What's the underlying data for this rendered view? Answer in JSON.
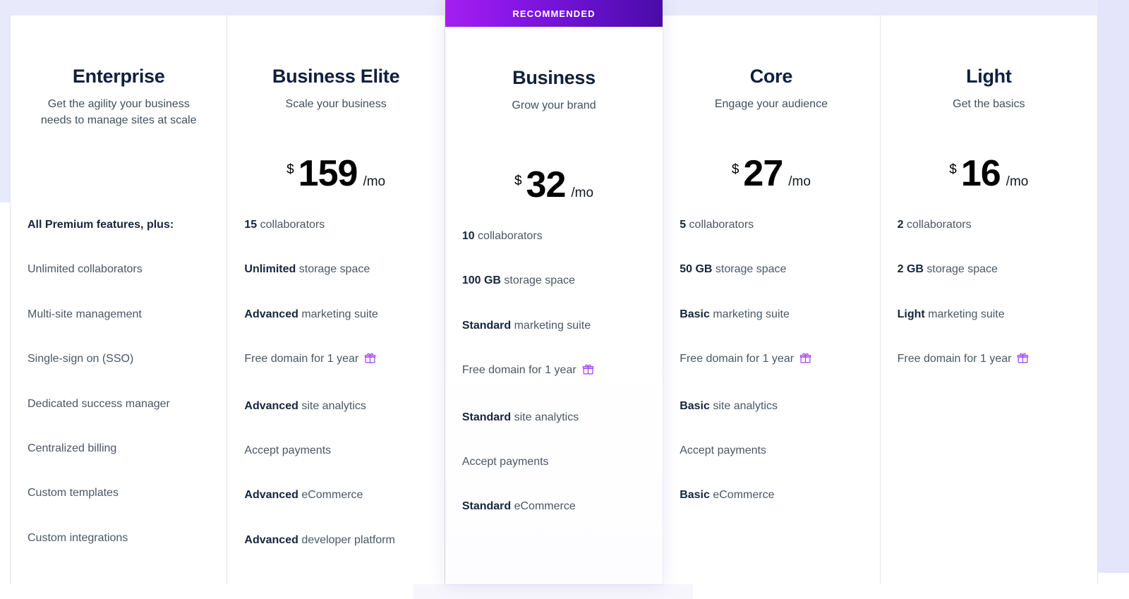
{
  "colors": {
    "page_background": "#ffffff",
    "backdrop_lavender": "#e8e9fb",
    "ribbon_gradient_start": "#a41ff0",
    "ribbon_gradient_end": "#4a0ba8",
    "heading_text": "#10203c",
    "body_text": "#4a5765",
    "gift_icon": "#a23ff0",
    "card_border": "#e3e5e8"
  },
  "ribbon": {
    "label": "RECOMMENDED"
  },
  "plans": [
    {
      "id": "enterprise",
      "name": "Enterprise",
      "tagline": "Get the agility your business needs to manage sites at scale",
      "featured": false,
      "has_price": false,
      "price": {
        "currency": "",
        "amount": "",
        "period": ""
      },
      "features": [
        {
          "strong": "All Premium features, plus:",
          "rest": "",
          "heading": true,
          "gift": false
        },
        {
          "strong": "",
          "rest": "Unlimited collaborators",
          "heading": false,
          "gift": false
        },
        {
          "strong": "",
          "rest": "Multi-site management",
          "heading": false,
          "gift": false
        },
        {
          "strong": "",
          "rest": "Single-sign on (SSO)",
          "heading": false,
          "gift": false
        },
        {
          "strong": "",
          "rest": "Dedicated success manager",
          "heading": false,
          "gift": false
        },
        {
          "strong": "",
          "rest": "Centralized billing",
          "heading": false,
          "gift": false
        },
        {
          "strong": "",
          "rest": "Custom templates",
          "heading": false,
          "gift": false
        },
        {
          "strong": "",
          "rest": "Custom integrations",
          "heading": false,
          "gift": false
        }
      ]
    },
    {
      "id": "business-elite",
      "name": "Business Elite",
      "tagline": "Scale your business",
      "featured": false,
      "has_price": true,
      "price": {
        "currency": "$",
        "amount": "159",
        "period": "/mo"
      },
      "features": [
        {
          "strong": "15",
          "rest": " collaborators",
          "heading": false,
          "gift": false
        },
        {
          "strong": "Unlimited",
          "rest": " storage space",
          "heading": false,
          "gift": false
        },
        {
          "strong": "Advanced",
          "rest": " marketing suite",
          "heading": false,
          "gift": false
        },
        {
          "strong": "",
          "rest": "Free domain for 1 year",
          "heading": false,
          "gift": true
        },
        {
          "strong": "Advanced",
          "rest": " site analytics",
          "heading": false,
          "gift": false
        },
        {
          "strong": "",
          "rest": "Accept payments",
          "heading": false,
          "gift": false
        },
        {
          "strong": "Advanced",
          "rest": " eCommerce",
          "heading": false,
          "gift": false
        },
        {
          "strong": "Advanced",
          "rest": " developer platform",
          "heading": false,
          "gift": false
        }
      ]
    },
    {
      "id": "business",
      "name": "Business",
      "tagline": "Grow your brand",
      "featured": true,
      "has_price": true,
      "price": {
        "currency": "$",
        "amount": "32",
        "period": "/mo"
      },
      "features": [
        {
          "strong": "10",
          "rest": " collaborators",
          "heading": false,
          "gift": false
        },
        {
          "strong": "100 GB",
          "rest": " storage space",
          "heading": false,
          "gift": false
        },
        {
          "strong": "Standard",
          "rest": " marketing suite",
          "heading": false,
          "gift": false
        },
        {
          "strong": "",
          "rest": "Free domain for 1 year",
          "heading": false,
          "gift": true
        },
        {
          "strong": "Standard",
          "rest": " site analytics",
          "heading": false,
          "gift": false
        },
        {
          "strong": "",
          "rest": "Accept payments",
          "heading": false,
          "gift": false
        },
        {
          "strong": "Standard",
          "rest": " eCommerce",
          "heading": false,
          "gift": false
        }
      ]
    },
    {
      "id": "core",
      "name": "Core",
      "tagline": "Engage your audience",
      "featured": false,
      "has_price": true,
      "price": {
        "currency": "$",
        "amount": "27",
        "period": "/mo"
      },
      "features": [
        {
          "strong": "5",
          "rest": " collaborators",
          "heading": false,
          "gift": false
        },
        {
          "strong": "50 GB",
          "rest": " storage space",
          "heading": false,
          "gift": false
        },
        {
          "strong": "Basic",
          "rest": " marketing suite",
          "heading": false,
          "gift": false
        },
        {
          "strong": "",
          "rest": "Free domain for 1 year",
          "heading": false,
          "gift": true
        },
        {
          "strong": "Basic",
          "rest": " site analytics",
          "heading": false,
          "gift": false
        },
        {
          "strong": "",
          "rest": "Accept payments",
          "heading": false,
          "gift": false
        },
        {
          "strong": "Basic",
          "rest": " eCommerce",
          "heading": false,
          "gift": false
        }
      ]
    },
    {
      "id": "light",
      "name": "Light",
      "tagline": "Get the basics",
      "featured": false,
      "has_price": true,
      "price": {
        "currency": "$",
        "amount": "16",
        "period": "/mo"
      },
      "features": [
        {
          "strong": "2",
          "rest": " collaborators",
          "heading": false,
          "gift": false
        },
        {
          "strong": "2 GB",
          "rest": " storage space",
          "heading": false,
          "gift": false
        },
        {
          "strong": "Light",
          "rest": " marketing suite",
          "heading": false,
          "gift": false
        },
        {
          "strong": "",
          "rest": "Free domain for 1 year",
          "heading": false,
          "gift": true
        }
      ]
    }
  ]
}
